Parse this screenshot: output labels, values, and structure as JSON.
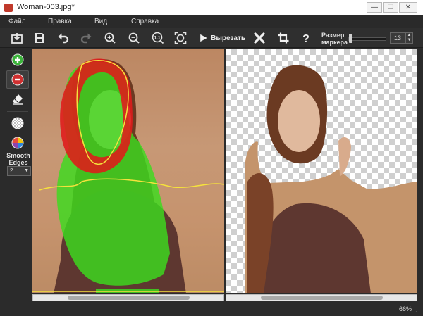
{
  "window": {
    "title": "Woman-003.jpg*",
    "minimize_glyph": "—",
    "maximize_glyph": "❐",
    "close_glyph": "✕"
  },
  "menu": [
    "Файл",
    "Правка",
    "Вид",
    "Справка"
  ],
  "toolbar": {
    "icons": [
      "open-icon",
      "save-icon",
      "undo-icon",
      "redo-icon",
      "zoom-in-icon",
      "zoom-out-icon",
      "zoom-actual-size-icon",
      "zoom-fit-icon",
      "cut-icon",
      "clear-icon",
      "crop-icon",
      "help-icon"
    ],
    "zoom_actual_label": "1:1",
    "cut_label": "Вырезать",
    "marker_size_label": "Размер маркера",
    "marker_size_value": "13",
    "marker_size_fraction": 0.02
  },
  "left_panel": {
    "tools": [
      "add-marker-icon",
      "remove-marker-icon",
      "eraser-icon",
      "transparency-icon",
      "color-background-icon"
    ],
    "smooth_edges_label": "Smooth Edges",
    "smooth_edges_value": "2"
  },
  "colors": {
    "keep_marker": "#3cdc1e",
    "remove_marker": "#e01a1a",
    "outline": "#f5e23c"
  },
  "scroll": {
    "left_thumb_start": 0.18,
    "left_thumb_end": 0.82,
    "right_thumb_start": 0.18,
    "right_thumb_end": 0.82
  },
  "status": {
    "zoom": "66%"
  }
}
